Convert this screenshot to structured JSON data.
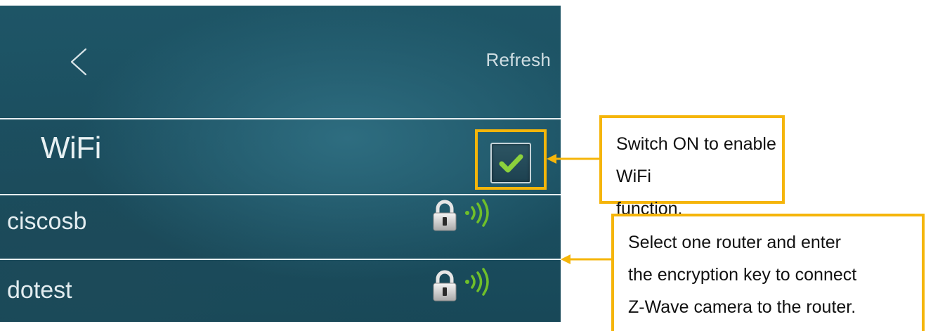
{
  "header": {
    "back_icon": "chevron-left-icon",
    "refresh_label": "Refresh"
  },
  "wifi": {
    "title": "WiFi",
    "enabled": true,
    "check_color": "#8cd23c"
  },
  "networks": [
    {
      "ssid": "ciscosb",
      "locked": true,
      "signal": "full"
    },
    {
      "ssid": "dotest",
      "locked": true,
      "signal": "full"
    }
  ],
  "callouts": {
    "switch": {
      "lines": [
        "Switch ON to enable WiFi",
        "function."
      ]
    },
    "select": {
      "lines": [
        "Select one router and enter",
        "the encryption key to connect",
        "Z-Wave camera to the router."
      ]
    }
  },
  "colors": {
    "accent": "#f5b50a",
    "panel_bg": "#1d5265",
    "signal_green": "#6fbf2a"
  }
}
